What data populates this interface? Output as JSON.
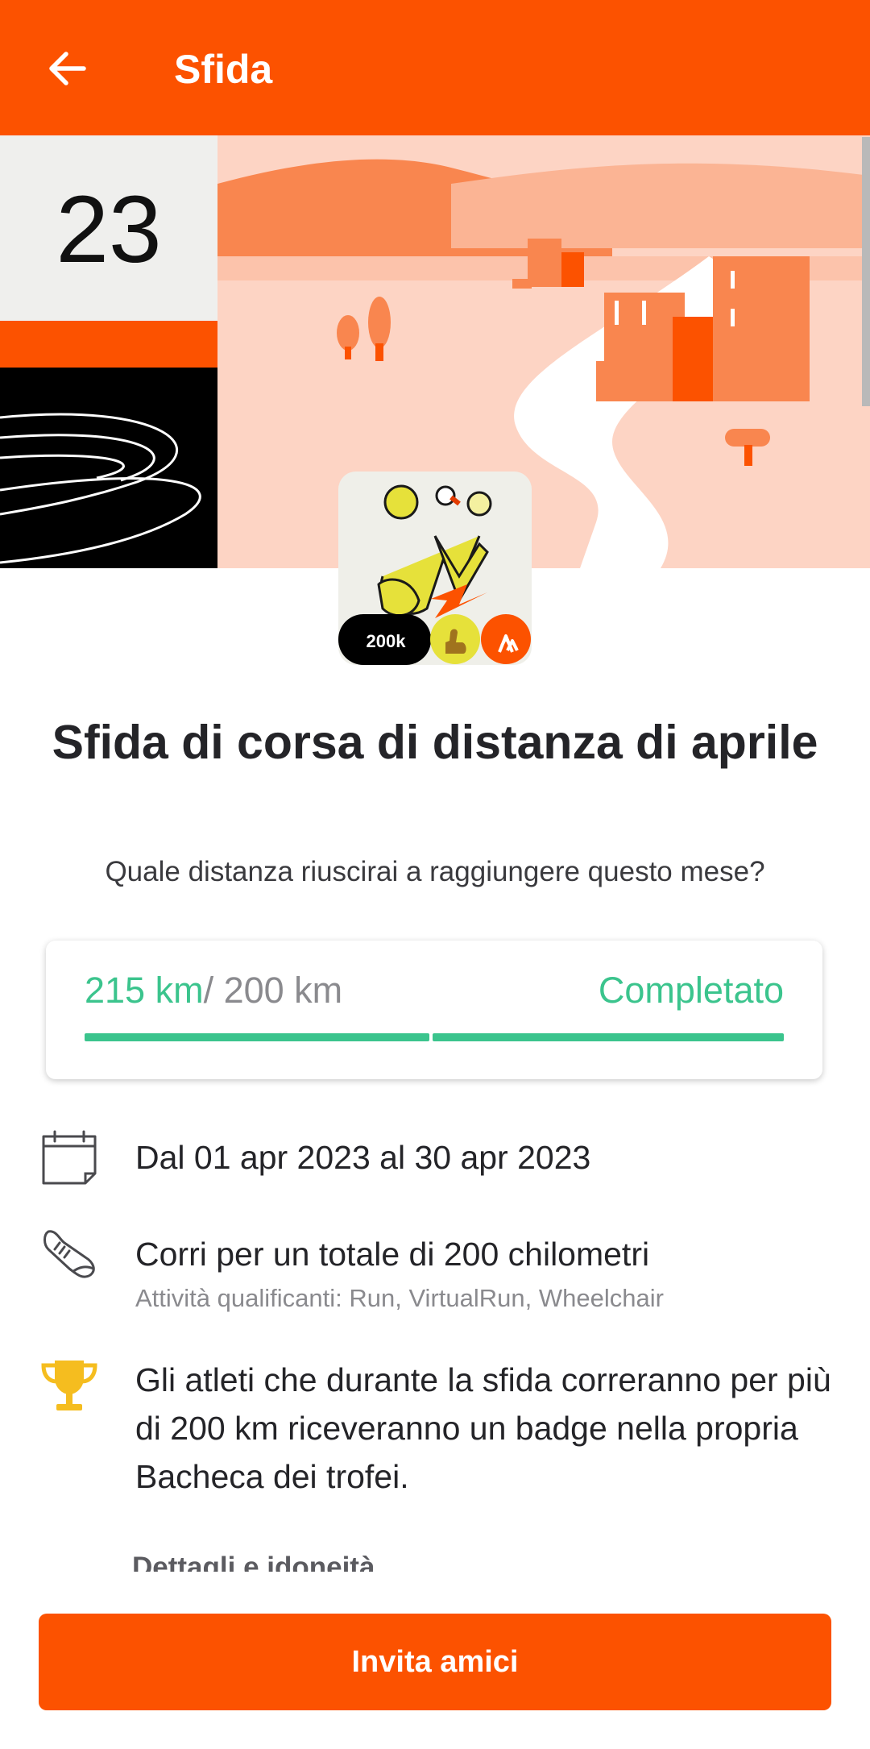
{
  "appbar": {
    "title": "Sfida",
    "back_icon": "arrow-left-icon"
  },
  "hero": {
    "calendar_day": "23",
    "brand_color": "#fc5200"
  },
  "badge": {
    "label": "200k"
  },
  "challenge": {
    "title": "Sfida di corsa di distanza di aprile",
    "subtitle": "Quale distanza riuscirai a raggiungere questo mese?"
  },
  "progress": {
    "current": "215 km",
    "goal": "/ 200 km",
    "status": "Completato",
    "fraction": 1.0,
    "color": "#3bc48d"
  },
  "details": {
    "dates": {
      "icon": "calendar-icon",
      "text": "Dal 01 apr 2023 al 30 apr 2023"
    },
    "goal": {
      "icon": "running-shoe-icon",
      "text": "Corri per un totale di 200 chilometri",
      "sub": "Attività qualificanti: Run, VirtualRun, Wheelchair"
    },
    "reward": {
      "icon": "trophy-icon",
      "text": "Gli atleti che durante la sfida correranno per più di 200 km riceveranno un badge nella propria Bacheca dei trofei."
    },
    "link": "Dettagli e idoneità"
  },
  "actions": {
    "invite": "Invita amici"
  }
}
